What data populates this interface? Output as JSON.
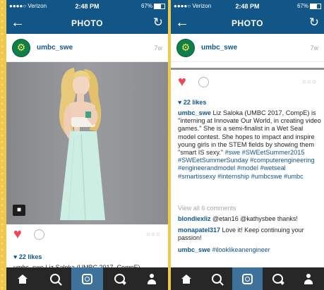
{
  "status": {
    "carrier": "●●●●○ Verizon",
    "time": "2:48 PM",
    "battery": "67%"
  },
  "header": {
    "title": "PHOTO"
  },
  "post": {
    "username": "umbc_swe",
    "age": "7w",
    "likes": "22 likes",
    "caption_user": "umbc_swe",
    "caption_text": "Liz Saloka (UMBC 2017, CompE) is \"interning at Innovate Our World, in creating video games.\" She is a semi-finalist in a Wet Seal model contest. She hopes to impact and inspire young girls in the STEM fields by showing them \"smart IS sexy.\"",
    "caption_tags": "#swe #SWEetSummer2015 #SWEetSummerSunday #computerengineering #engineerandmodel #model #wetseal #smartissexy #internship #umbcswe #umbc",
    "view_all": "View all 6 comments",
    "comments": [
      {
        "user": "blondiexliz",
        "text": "@etan16 @kathysbee thanks!"
      },
      {
        "user": "monapatel317",
        "text": "Love it! Keep continuing your passion!"
      },
      {
        "user": "umbc_swe",
        "text": "#ilooklikeanengineer"
      }
    ],
    "left_caption_partial": "umbc_swe Liz Saloka (UMBC 2017, CompE)"
  },
  "icons": {
    "back": "arrow-left-icon",
    "refresh": "refresh-icon",
    "like": "heart-icon",
    "comment": "comment-icon",
    "more": "more-options-icon",
    "tag": "user-tag-icon"
  },
  "tabs": [
    {
      "name": "home-icon"
    },
    {
      "name": "search-icon"
    },
    {
      "name": "camera-icon"
    },
    {
      "name": "activity-icon"
    },
    {
      "name": "profile-icon"
    }
  ],
  "colors": {
    "brand_blue": "#125688",
    "like_red": "#ed4956",
    "tab_active": "#3f729b",
    "tab_bar": "#272727"
  }
}
